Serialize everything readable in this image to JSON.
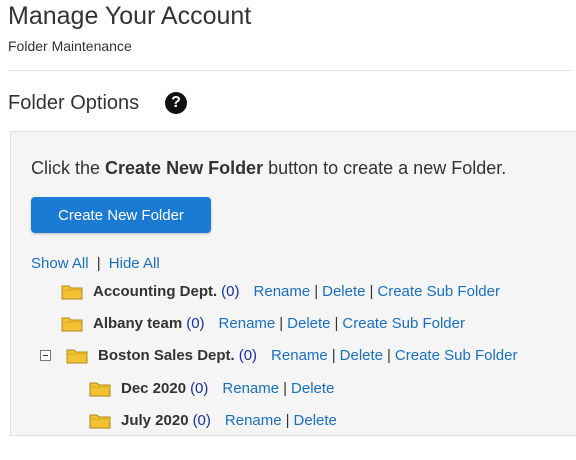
{
  "header": {
    "title": "Manage Your Account",
    "subtitle": "Folder Maintenance"
  },
  "section": {
    "title": "Folder Options",
    "help_icon": "question-circle-icon",
    "help_glyph": "?"
  },
  "instructions": {
    "prefix": "Click the ",
    "bold": "Create New Folder",
    "suffix": " button to create a new Folder."
  },
  "create_button": {
    "label": "Create New Folder",
    "color": "#1a7ad4"
  },
  "toggle": {
    "show_all": "Show All",
    "separator": "|",
    "hide_all": "Hide All"
  },
  "folders": [
    {
      "name": "Accounting Dept.",
      "count": "(0)",
      "actions": [
        "Rename",
        "Delete",
        "Create Sub Folder"
      ]
    },
    {
      "name": "Albany team",
      "count": "(0)",
      "actions": [
        "Rename",
        "Delete",
        "Create Sub Folder"
      ]
    },
    {
      "name": "Boston Sales Dept.",
      "count": "(0)",
      "expanded": true,
      "actions": [
        "Rename",
        "Delete",
        "Create Sub Folder"
      ]
    },
    {
      "name": "Dec 2020",
      "count": "(0)",
      "actions": [
        "Rename",
        "Delete"
      ]
    },
    {
      "name": "July 2020",
      "count": "(0)",
      "actions": [
        "Rename",
        "Delete"
      ]
    }
  ],
  "colors": {
    "link": "#1a6fc0",
    "count": "#1a2fa0",
    "folder": "#f2c232"
  }
}
